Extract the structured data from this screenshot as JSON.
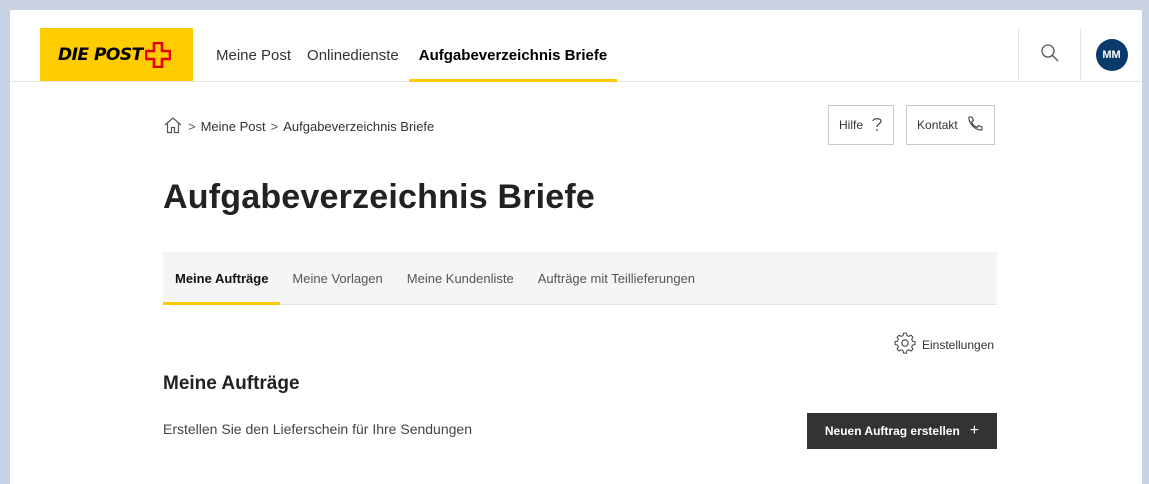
{
  "header": {
    "logo_text": "DIE POST",
    "nav": [
      {
        "label": "Meine Post"
      },
      {
        "label": "Onlinedienste"
      },
      {
        "label": "Aufgabeverzeichnis Briefe",
        "active": true
      }
    ],
    "avatar_initials": "MM",
    "icons": {
      "search": "search-icon",
      "logo_cross": "swiss-cross-icon"
    },
    "colors": {
      "brand_yellow": "#ffcc00",
      "avatar": "#0a3a6b"
    }
  },
  "breadcrumb": {
    "items": [
      "Meine Post",
      "Aufgabeverzeichnis Briefe"
    ],
    "home_icon": "home-icon"
  },
  "help": {
    "hilfe_label": "Hilfe",
    "kontakt_label": "Kontakt"
  },
  "page": {
    "title": "Aufgabeverzeichnis Briefe"
  },
  "tabs": [
    {
      "label": "Meine Aufträge",
      "active": true
    },
    {
      "label": "Meine Vorlagen"
    },
    {
      "label": "Meine Kundenliste"
    },
    {
      "label": "Aufträge mit Teillieferungen"
    }
  ],
  "settings": {
    "label": "Einstellungen",
    "icon": "gear-icon"
  },
  "section": {
    "title": "Meine Aufträge",
    "description": "Erstellen Sie den Lieferschein für Ihre Sendungen",
    "new_order_label": "Neuen Auftrag erstellen",
    "colors": {
      "button_bg": "#333333"
    }
  }
}
